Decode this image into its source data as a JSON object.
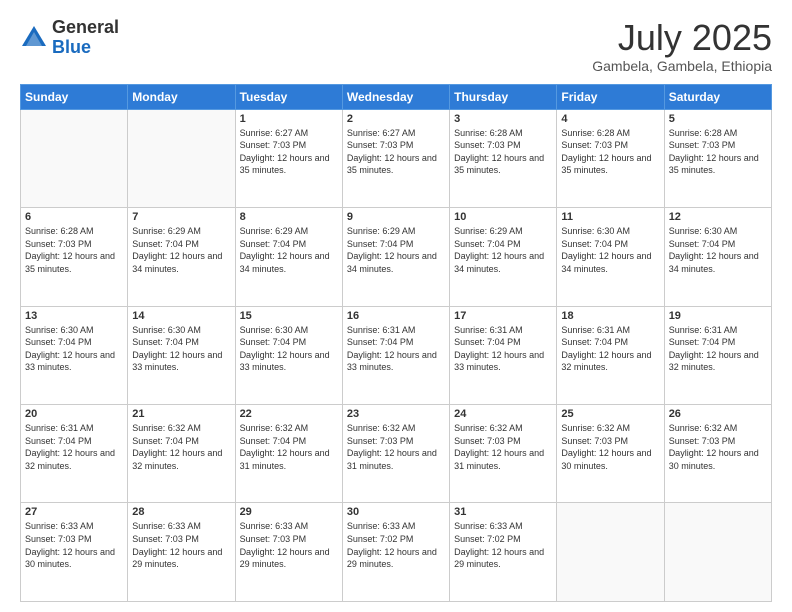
{
  "logo": {
    "general": "General",
    "blue": "Blue"
  },
  "header": {
    "month": "July 2025",
    "location": "Gambela, Gambela, Ethiopia"
  },
  "days_of_week": [
    "Sunday",
    "Monday",
    "Tuesday",
    "Wednesday",
    "Thursday",
    "Friday",
    "Saturday"
  ],
  "weeks": [
    [
      {
        "day": "",
        "sunrise": "",
        "sunset": "",
        "daylight": ""
      },
      {
        "day": "",
        "sunrise": "",
        "sunset": "",
        "daylight": ""
      },
      {
        "day": "1",
        "sunrise": "Sunrise: 6:27 AM",
        "sunset": "Sunset: 7:03 PM",
        "daylight": "Daylight: 12 hours and 35 minutes."
      },
      {
        "day": "2",
        "sunrise": "Sunrise: 6:27 AM",
        "sunset": "Sunset: 7:03 PM",
        "daylight": "Daylight: 12 hours and 35 minutes."
      },
      {
        "day": "3",
        "sunrise": "Sunrise: 6:28 AM",
        "sunset": "Sunset: 7:03 PM",
        "daylight": "Daylight: 12 hours and 35 minutes."
      },
      {
        "day": "4",
        "sunrise": "Sunrise: 6:28 AM",
        "sunset": "Sunset: 7:03 PM",
        "daylight": "Daylight: 12 hours and 35 minutes."
      },
      {
        "day": "5",
        "sunrise": "Sunrise: 6:28 AM",
        "sunset": "Sunset: 7:03 PM",
        "daylight": "Daylight: 12 hours and 35 minutes."
      }
    ],
    [
      {
        "day": "6",
        "sunrise": "Sunrise: 6:28 AM",
        "sunset": "Sunset: 7:03 PM",
        "daylight": "Daylight: 12 hours and 35 minutes."
      },
      {
        "day": "7",
        "sunrise": "Sunrise: 6:29 AM",
        "sunset": "Sunset: 7:04 PM",
        "daylight": "Daylight: 12 hours and 34 minutes."
      },
      {
        "day": "8",
        "sunrise": "Sunrise: 6:29 AM",
        "sunset": "Sunset: 7:04 PM",
        "daylight": "Daylight: 12 hours and 34 minutes."
      },
      {
        "day": "9",
        "sunrise": "Sunrise: 6:29 AM",
        "sunset": "Sunset: 7:04 PM",
        "daylight": "Daylight: 12 hours and 34 minutes."
      },
      {
        "day": "10",
        "sunrise": "Sunrise: 6:29 AM",
        "sunset": "Sunset: 7:04 PM",
        "daylight": "Daylight: 12 hours and 34 minutes."
      },
      {
        "day": "11",
        "sunrise": "Sunrise: 6:30 AM",
        "sunset": "Sunset: 7:04 PM",
        "daylight": "Daylight: 12 hours and 34 minutes."
      },
      {
        "day": "12",
        "sunrise": "Sunrise: 6:30 AM",
        "sunset": "Sunset: 7:04 PM",
        "daylight": "Daylight: 12 hours and 34 minutes."
      }
    ],
    [
      {
        "day": "13",
        "sunrise": "Sunrise: 6:30 AM",
        "sunset": "Sunset: 7:04 PM",
        "daylight": "Daylight: 12 hours and 33 minutes."
      },
      {
        "day": "14",
        "sunrise": "Sunrise: 6:30 AM",
        "sunset": "Sunset: 7:04 PM",
        "daylight": "Daylight: 12 hours and 33 minutes."
      },
      {
        "day": "15",
        "sunrise": "Sunrise: 6:30 AM",
        "sunset": "Sunset: 7:04 PM",
        "daylight": "Daylight: 12 hours and 33 minutes."
      },
      {
        "day": "16",
        "sunrise": "Sunrise: 6:31 AM",
        "sunset": "Sunset: 7:04 PM",
        "daylight": "Daylight: 12 hours and 33 minutes."
      },
      {
        "day": "17",
        "sunrise": "Sunrise: 6:31 AM",
        "sunset": "Sunset: 7:04 PM",
        "daylight": "Daylight: 12 hours and 33 minutes."
      },
      {
        "day": "18",
        "sunrise": "Sunrise: 6:31 AM",
        "sunset": "Sunset: 7:04 PM",
        "daylight": "Daylight: 12 hours and 32 minutes."
      },
      {
        "day": "19",
        "sunrise": "Sunrise: 6:31 AM",
        "sunset": "Sunset: 7:04 PM",
        "daylight": "Daylight: 12 hours and 32 minutes."
      }
    ],
    [
      {
        "day": "20",
        "sunrise": "Sunrise: 6:31 AM",
        "sunset": "Sunset: 7:04 PM",
        "daylight": "Daylight: 12 hours and 32 minutes."
      },
      {
        "day": "21",
        "sunrise": "Sunrise: 6:32 AM",
        "sunset": "Sunset: 7:04 PM",
        "daylight": "Daylight: 12 hours and 32 minutes."
      },
      {
        "day": "22",
        "sunrise": "Sunrise: 6:32 AM",
        "sunset": "Sunset: 7:04 PM",
        "daylight": "Daylight: 12 hours and 31 minutes."
      },
      {
        "day": "23",
        "sunrise": "Sunrise: 6:32 AM",
        "sunset": "Sunset: 7:03 PM",
        "daylight": "Daylight: 12 hours and 31 minutes."
      },
      {
        "day": "24",
        "sunrise": "Sunrise: 6:32 AM",
        "sunset": "Sunset: 7:03 PM",
        "daylight": "Daylight: 12 hours and 31 minutes."
      },
      {
        "day": "25",
        "sunrise": "Sunrise: 6:32 AM",
        "sunset": "Sunset: 7:03 PM",
        "daylight": "Daylight: 12 hours and 30 minutes."
      },
      {
        "day": "26",
        "sunrise": "Sunrise: 6:32 AM",
        "sunset": "Sunset: 7:03 PM",
        "daylight": "Daylight: 12 hours and 30 minutes."
      }
    ],
    [
      {
        "day": "27",
        "sunrise": "Sunrise: 6:33 AM",
        "sunset": "Sunset: 7:03 PM",
        "daylight": "Daylight: 12 hours and 30 minutes."
      },
      {
        "day": "28",
        "sunrise": "Sunrise: 6:33 AM",
        "sunset": "Sunset: 7:03 PM",
        "daylight": "Daylight: 12 hours and 29 minutes."
      },
      {
        "day": "29",
        "sunrise": "Sunrise: 6:33 AM",
        "sunset": "Sunset: 7:03 PM",
        "daylight": "Daylight: 12 hours and 29 minutes."
      },
      {
        "day": "30",
        "sunrise": "Sunrise: 6:33 AM",
        "sunset": "Sunset: 7:02 PM",
        "daylight": "Daylight: 12 hours and 29 minutes."
      },
      {
        "day": "31",
        "sunrise": "Sunrise: 6:33 AM",
        "sunset": "Sunset: 7:02 PM",
        "daylight": "Daylight: 12 hours and 29 minutes."
      },
      {
        "day": "",
        "sunrise": "",
        "sunset": "",
        "daylight": ""
      },
      {
        "day": "",
        "sunrise": "",
        "sunset": "",
        "daylight": ""
      }
    ]
  ]
}
